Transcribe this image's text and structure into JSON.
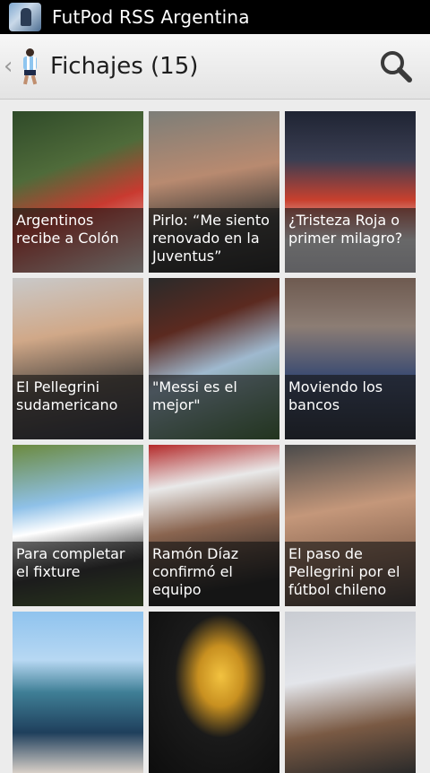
{
  "statusbar": {
    "app_title": "FutPod RSS Argentina"
  },
  "actionbar": {
    "section_title": "Fichajes (15)"
  },
  "articles": [
    {
      "title": "Argentinos recibe a Colón"
    },
    {
      "title": "Pirlo: “Me siento renovado en la Juventus”"
    },
    {
      "title": "¿Tristeza Roja o primer milagro?"
    },
    {
      "title": "El Pellegrini sudamericano"
    },
    {
      "title": "\"Messi es el mejor\""
    },
    {
      "title": "Moviendo los bancos"
    },
    {
      "title": "Para completar el fixture"
    },
    {
      "title": "Ramón Díaz confirmó el equipo"
    },
    {
      "title": "El paso de Pellegrini por el fútbol chileno"
    }
  ]
}
